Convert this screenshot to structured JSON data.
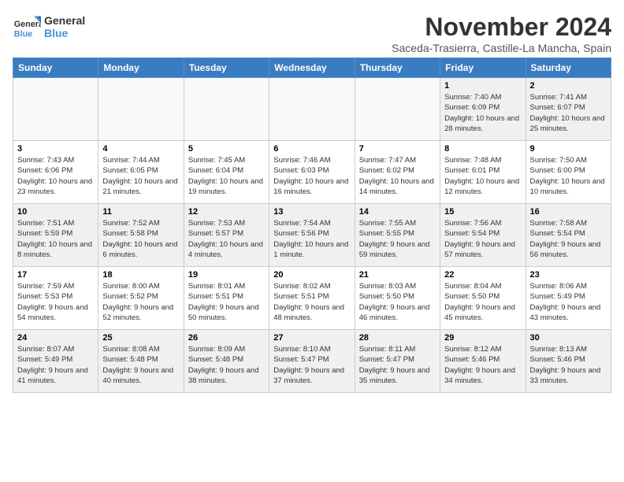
{
  "logo": {
    "name": "General Blue",
    "line1": "General",
    "line2": "Blue"
  },
  "title": "November 2024",
  "subtitle": "Saceda-Trasierra, Castille-La Mancha, Spain",
  "days_of_week": [
    "Sunday",
    "Monday",
    "Tuesday",
    "Wednesday",
    "Thursday",
    "Friday",
    "Saturday"
  ],
  "weeks": [
    [
      {
        "day": "",
        "info": ""
      },
      {
        "day": "",
        "info": ""
      },
      {
        "day": "",
        "info": ""
      },
      {
        "day": "",
        "info": ""
      },
      {
        "day": "",
        "info": ""
      },
      {
        "day": "1",
        "info": "Sunrise: 7:40 AM\nSunset: 6:09 PM\nDaylight: 10 hours and 28 minutes."
      },
      {
        "day": "2",
        "info": "Sunrise: 7:41 AM\nSunset: 6:07 PM\nDaylight: 10 hours and 25 minutes."
      }
    ],
    [
      {
        "day": "3",
        "info": "Sunrise: 7:43 AM\nSunset: 6:06 PM\nDaylight: 10 hours and 23 minutes."
      },
      {
        "day": "4",
        "info": "Sunrise: 7:44 AM\nSunset: 6:05 PM\nDaylight: 10 hours and 21 minutes."
      },
      {
        "day": "5",
        "info": "Sunrise: 7:45 AM\nSunset: 6:04 PM\nDaylight: 10 hours and 19 minutes."
      },
      {
        "day": "6",
        "info": "Sunrise: 7:46 AM\nSunset: 6:03 PM\nDaylight: 10 hours and 16 minutes."
      },
      {
        "day": "7",
        "info": "Sunrise: 7:47 AM\nSunset: 6:02 PM\nDaylight: 10 hours and 14 minutes."
      },
      {
        "day": "8",
        "info": "Sunrise: 7:48 AM\nSunset: 6:01 PM\nDaylight: 10 hours and 12 minutes."
      },
      {
        "day": "9",
        "info": "Sunrise: 7:50 AM\nSunset: 6:00 PM\nDaylight: 10 hours and 10 minutes."
      }
    ],
    [
      {
        "day": "10",
        "info": "Sunrise: 7:51 AM\nSunset: 5:59 PM\nDaylight: 10 hours and 8 minutes."
      },
      {
        "day": "11",
        "info": "Sunrise: 7:52 AM\nSunset: 5:58 PM\nDaylight: 10 hours and 6 minutes."
      },
      {
        "day": "12",
        "info": "Sunrise: 7:53 AM\nSunset: 5:57 PM\nDaylight: 10 hours and 4 minutes."
      },
      {
        "day": "13",
        "info": "Sunrise: 7:54 AM\nSunset: 5:56 PM\nDaylight: 10 hours and 1 minute."
      },
      {
        "day": "14",
        "info": "Sunrise: 7:55 AM\nSunset: 5:55 PM\nDaylight: 9 hours and 59 minutes."
      },
      {
        "day": "15",
        "info": "Sunrise: 7:56 AM\nSunset: 5:54 PM\nDaylight: 9 hours and 57 minutes."
      },
      {
        "day": "16",
        "info": "Sunrise: 7:58 AM\nSunset: 5:54 PM\nDaylight: 9 hours and 56 minutes."
      }
    ],
    [
      {
        "day": "17",
        "info": "Sunrise: 7:59 AM\nSunset: 5:53 PM\nDaylight: 9 hours and 54 minutes."
      },
      {
        "day": "18",
        "info": "Sunrise: 8:00 AM\nSunset: 5:52 PM\nDaylight: 9 hours and 52 minutes."
      },
      {
        "day": "19",
        "info": "Sunrise: 8:01 AM\nSunset: 5:51 PM\nDaylight: 9 hours and 50 minutes."
      },
      {
        "day": "20",
        "info": "Sunrise: 8:02 AM\nSunset: 5:51 PM\nDaylight: 9 hours and 48 minutes."
      },
      {
        "day": "21",
        "info": "Sunrise: 8:03 AM\nSunset: 5:50 PM\nDaylight: 9 hours and 46 minutes."
      },
      {
        "day": "22",
        "info": "Sunrise: 8:04 AM\nSunset: 5:50 PM\nDaylight: 9 hours and 45 minutes."
      },
      {
        "day": "23",
        "info": "Sunrise: 8:06 AM\nSunset: 5:49 PM\nDaylight: 9 hours and 43 minutes."
      }
    ],
    [
      {
        "day": "24",
        "info": "Sunrise: 8:07 AM\nSunset: 5:49 PM\nDaylight: 9 hours and 41 minutes."
      },
      {
        "day": "25",
        "info": "Sunrise: 8:08 AM\nSunset: 5:48 PM\nDaylight: 9 hours and 40 minutes."
      },
      {
        "day": "26",
        "info": "Sunrise: 8:09 AM\nSunset: 5:48 PM\nDaylight: 9 hours and 38 minutes."
      },
      {
        "day": "27",
        "info": "Sunrise: 8:10 AM\nSunset: 5:47 PM\nDaylight: 9 hours and 37 minutes."
      },
      {
        "day": "28",
        "info": "Sunrise: 8:11 AM\nSunset: 5:47 PM\nDaylight: 9 hours and 35 minutes."
      },
      {
        "day": "29",
        "info": "Sunrise: 8:12 AM\nSunset: 5:46 PM\nDaylight: 9 hours and 34 minutes."
      },
      {
        "day": "30",
        "info": "Sunrise: 8:13 AM\nSunset: 5:46 PM\nDaylight: 9 hours and 33 minutes."
      }
    ]
  ]
}
